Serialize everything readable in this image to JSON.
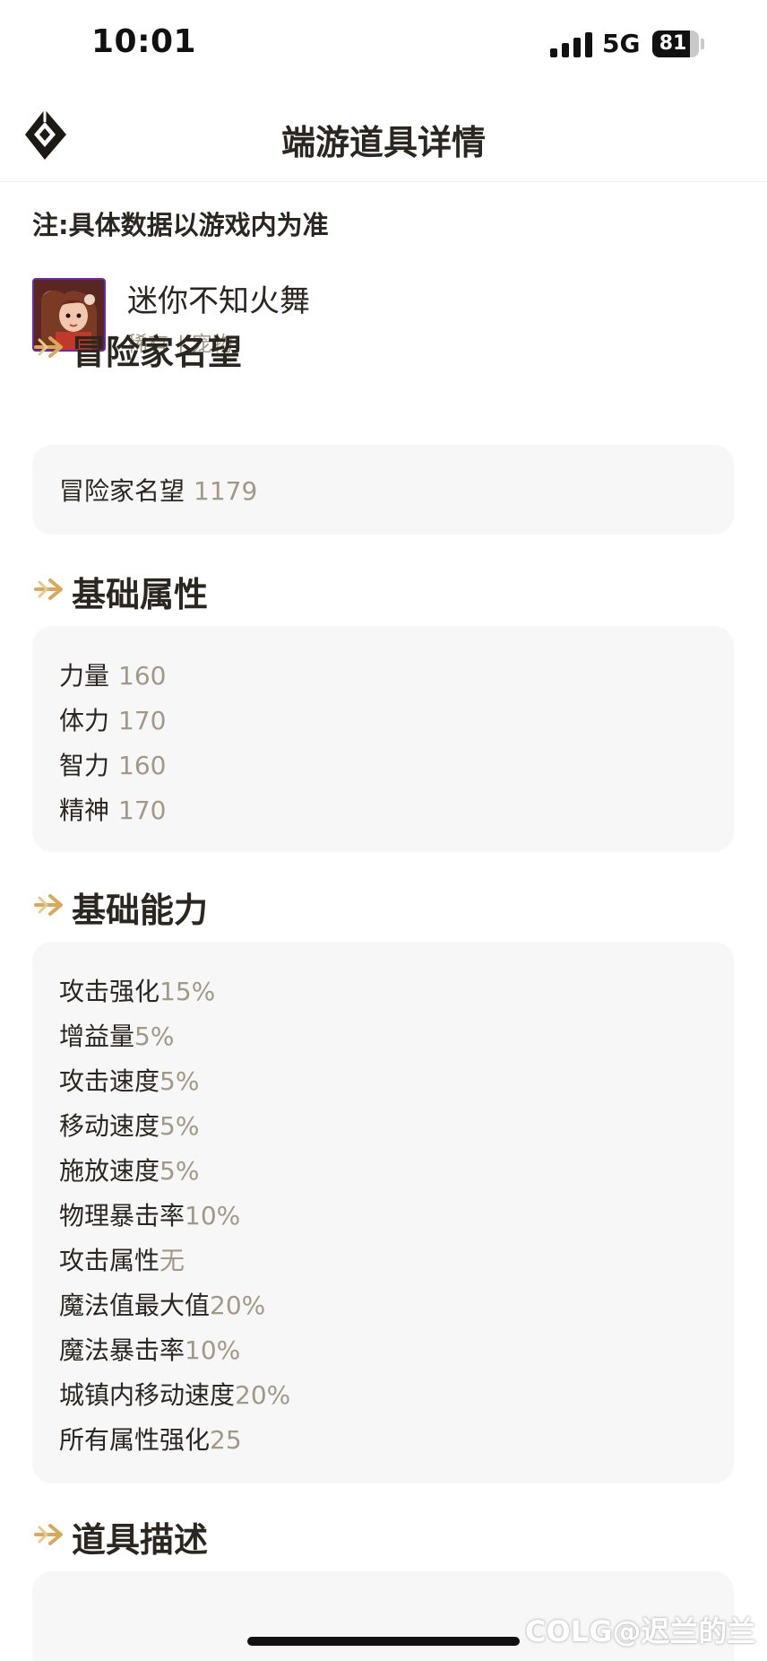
{
  "status_bar": {
    "time": "10:01",
    "network": "5G",
    "battery": "81",
    "battery_level": 0.81
  },
  "header": {
    "title": "端游道具详情"
  },
  "note": "注:具体数据以游戏内为准",
  "item": {
    "name": "迷你不知火舞",
    "rarity": "稀有",
    "separator": "|",
    "type": "宠物"
  },
  "sections": {
    "reputation": {
      "title": "冒险家名望",
      "rows": [
        {
          "label": "冒险家名望",
          "value": "1179"
        }
      ]
    },
    "base_attributes": {
      "title": "基础属性",
      "rows": [
        {
          "label": "力量",
          "value": "160"
        },
        {
          "label": "体力",
          "value": "170"
        },
        {
          "label": "智力",
          "value": "160"
        },
        {
          "label": "精神",
          "value": "170"
        }
      ]
    },
    "base_abilities": {
      "title": "基础能力",
      "rows": [
        {
          "label": "攻击强化",
          "value": "15%"
        },
        {
          "label": "增益量",
          "value": "5%"
        },
        {
          "label": "攻击速度",
          "value": "5%"
        },
        {
          "label": "移动速度",
          "value": "5%"
        },
        {
          "label": "施放速度",
          "value": "5%"
        },
        {
          "label": "物理暴击率",
          "value": "10%"
        },
        {
          "label": "攻击属性",
          "value": "无"
        },
        {
          "label": "魔法值最大值",
          "value": "20%"
        },
        {
          "label": "魔法暴击率",
          "value": "10%"
        },
        {
          "label": "城镇内移动速度",
          "value": "20%"
        },
        {
          "label": "所有属性强化",
          "value": "25"
        }
      ]
    },
    "description": {
      "title": "道具描述"
    }
  },
  "watermark": "COLG@迟兰的兰",
  "colors": {
    "accent": "#d9a85a",
    "value": "#a39886",
    "text": "#2b2620",
    "card_bg": "#f7f7f7",
    "icon_border": "#6a2aa8"
  }
}
